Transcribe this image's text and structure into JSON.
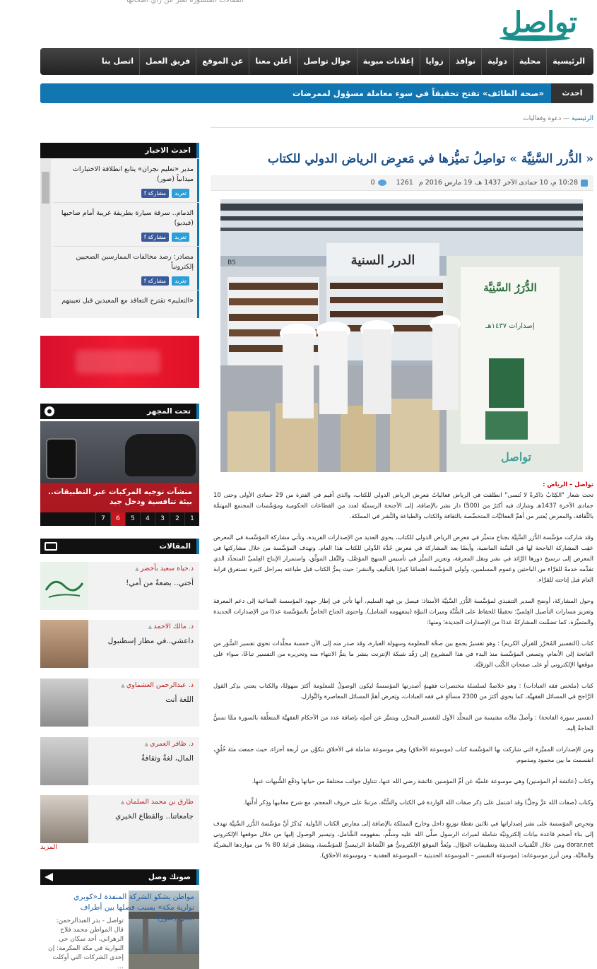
{
  "site": {
    "logo": "تواصل",
    "topline": "المقالات المنشورة تعبّر عن رأي أصحابها"
  },
  "nav": {
    "items": [
      "الرئيسية",
      "محلية",
      "دولية",
      "نوافذ",
      "زوايا",
      "إعلانات مبوبة",
      "جوال تواصل",
      "أعلن معنا",
      "عن الموقع",
      "فريق العمل",
      "اتصل بنا"
    ]
  },
  "ticker": {
    "label": "احدث الأخبار",
    "text": "«صحة الطائف» تفتح تحقيقاً في سوء معاملة مسؤول لممرضات"
  },
  "breadcrumb": {
    "home": "الرئيسية",
    "sep": "—",
    "section": "دعوة وفعاليات"
  },
  "article": {
    "title": "« الدُّرر السَّنِيَّة » تواصِلُ تميُّزها في مَعرِض الرياض الدولي للكتاب",
    "meta": {
      "datetime": "10:28 م، 10 جمادى الآخر 1437 هـ، 19 مارس 2016 م",
      "views": "1261",
      "comments": "0"
    },
    "photo": {
      "booth_sign": "الدرر السنية",
      "booth_code": "B5",
      "poster_title": "الدُّرَرُ السَّنِيَّة",
      "poster_sub": "إصدارات ١٤٣٧هـ",
      "watermark": "تواصل"
    },
    "source": "تواصل – الرياض :",
    "paragraphs": [
      "تحت شعار \"الكِتَابُ ذاكرةٌ لا تُنسى\" انطلقت في الرياض فعالياتُ مَعرِض الرياض الدولي للكتاب، والذي أقيم في الفترة من 29 جمادى الأولى وحتى 10 جمادى الآخرة 1437هـ وشارك فيه أكثرُ من (500) دار نشر بالإضافة، إلى الأجنحة الرسميَّة لعدد من القطاعات الحكومية ومؤسَّسات المجتمع المهتمَّة بالثَّقافة، والمعرض يُعتبر من أهمِّ الفعاليَّات المتخصِّصة بالثقافة والكتاب والطباعة والنَّشر في المملكة.",
      "وقد شاركت مؤسَّسة الدُّرَر السَّنِيَّة بجناح متميِّز في مَعرِض الرياض الدولي للكتاب، يحوي العديد من الإصدارات الفريدة، وتأتي مشاركة المؤسَّسة في المعرض عقِب المشاركة الناجحة لها في السَّنة الماضية، وأيضًا بعد المشاركة في مَعرِض جُدَّة الدَّولي للكتاب هذا العام. وتهدف المؤسَّسة من خلال مشاركتها في المعرض إلى ترسيخ دورها الرَّائد في نشر ونقل المعرفة، وتعزيز التميُّز في تأسيس المنهج المؤصَّل، والنَّقل الموثَّق، واستمرار الإنتاج العِلميِّ المتجدِّد الذي تقدِّمه خدمةً للقرَّاء من الباحثين وعموم المسلمين، وتُولي المؤسَّسة اهتمامًا كبيرًا بالتأليف والنشر؛ حيث يمرُّ الكتاب قبل طباعته بمراحل كثيرة تستغرق قرابة العام قبل إتاحته للقرَّاء.",
      "وحول المشاركة، أوضح المدير التنفيذي لمؤسَّسة الدُّرَر السَّنِيَّة الأستاذ: فيصل بن فهد السليم، أنها تأتي في إطار جهود المؤسسة الساعية إلى دعم المعرفة وتعزيز مَسارات التأصيل العِلميِّ؛ تحقيقًا للحفاظ على السُّنَّة وميراث النبوَّة (بمفهومه الشامل). واحتوى الجناح الخاصُّ بالمؤسَّسة عددًا من الإصدارات الجديدة والمتميِّزة، كما تضمَّنت المشاركةُ عددًا من الإصدارات الجديدة؛ ومنها:",
      "كتاب (التفسير المُحَرَّر للقرآن الكريم) : وهو تفسيرٌ يجمع بين صحَّة المعلومة وسهولة العبارة، وقد صدر منه إلى الآن خمسة مجلَّدات تحوي تفسير السُّوَر من الفاتحة إلى الأنعام، وتسعى المؤسَّسة منذ البدء في هذا المشروع إلى رَفْد شبكة الإنترنت بنشر ما يتمُّ الانتهاء منه وتحريره من التفسير تباعًا، سواء على موقعها الإلكتروني أو على صفحاتِ الكُتُب الورَقيَّة.",
      "كتاب (ملخص فقه العبادات) : وهو خلاصةٌ لسلسلة مختصرات فقهيةٍ أصدرتها المؤسسةُ ليكون الوصولُ للمعلومة أكثرَ سهولةً، والكتاب يعتني بذِكر القول الرَّاجح في المسائل الفقهيَّة، كما يحوي أكثرَ من 2300 مسألةٍ في فقه العبادات، ويَعرض أهمَّ المسائل المعاصرة والنَّوازل.",
      "(تفسير سورة الفاتحة) : وأصلُ مادَّته مقتبسة من المجلَّد الأول للتفسير المحرَّر، ويتميَّز عن أصلِه بإضافة عدد من الأحكام الفقهيَّة المتعلِّقة بالسورة ممَّا تمسُّ الحاجةُ إليه.",
      "ومن الإصدارات المميَّزة التي شاركت بها المؤسَّسة كتاب (موسوعة الأخلاق) وهي موسوعة شاملة في الأخلاق تتكوَّن من أربعة أجزاء، حيث جمعت مئةَ خُلُقٍ، انقسمت ما بين محمود ومذموم.",
      "وكتاب (عائشة أم المؤمنين) وهي موسوعة علميَّة عن أمِّ المؤمنين عائشة رضي الله عنها، تتناول جوانب مختلفةً من حياتها ودَفْع الشُّبهات عنها.",
      "وكتاب (صفات الله عزَّ وجلَّ) وقد اشتمل على ذِكر صفات الله الواردة في الكتاب والسُّنَّة، مرتبةً على حروف المعجم، مع شرح معانيها وذِكر أدلَّتها.",
      "وتحرِص المؤسسة على نشر إصداراتها في ثلاثين نقطةَ توزيعٍ داخل وخارج المملكة بالإضافة إلى معارض الكتاب الدَّولية. يُذكَرُ أنَّ مؤسَّسة الدُّرَر السَّنِيَّة تهدف إلى بناء أضخم قاعدة بيانات إلكترونيَّة شاملة لميراث الرسول صلَّى الله عليه وسلَّم، بمفهومه الشَّامل، وتيسير الوصول إليها من خلال موقعها الإلكتروني dorar.net ومن خلال التَّقنيات الحديثة وتطبيقات الجوَّال. ويُعدُّ الموقع الإلكترونيُّ هو النَّشاط الرئيسيُّ للمؤسَّسة، ويشغل قرابةَ 80 % من مواردها البشريَّة والماليَّة، ومن أبرز موسوعاته: (موسوعة التفسير – الموسوعة الحديثية – الموسوعة العقدية – وموسوعة الأخلاق)."
    ]
  },
  "sidebar": {
    "latest": {
      "title": "احدث الاخبار",
      "share_tw": "تغريد",
      "share_fb": "f مشاركة",
      "items": [
        "مدير «تعليم نجران» يتابع انطلاقة الاختبارات ميدانياً (صور)",
        "الدمام.. سرقة سيارة بطريقة غريبة أمام صاحبها (فيديو)",
        "مصادر: رصد مخالفات الممارسين الصحيين إلكترونياً",
        "«التعليم» تقترح التعاقد مع المعيدين قبل تعيينهم"
      ]
    },
    "micro": {
      "title": "تحت المجهر",
      "caption": "منشآت توجيه المركبات عبر التطبيقات.. بيئة تنافسية ودخل جيد",
      "pages": [
        "1",
        "2",
        "3",
        "4",
        "5",
        "6",
        "7"
      ],
      "active_page": "6"
    },
    "articles": {
      "title": "المقالات",
      "items": [
        {
          "author": "د.حياة سعيد بأخضر",
          "title": "أختي.. بضعةٌ من أمي!"
        },
        {
          "author": "د. مالك الاحمد",
          "title": "داعشي..في مطار إسطنبول"
        },
        {
          "author": "د. عبدالرحمن العشماوي",
          "title": "اللغة أنت"
        },
        {
          "author": "د. ظافر العمري",
          "title": "المال، لغةٌ وثقافةٌ"
        },
        {
          "author": "طارق بن محمد السلمان",
          "title": "جامعاتنا.. والقطاع الخيري"
        }
      ],
      "more": "المزيد"
    },
    "audio": {
      "title": "صوتك وصل",
      "item_title": "مواطن يشكو الشركة المنفذة لـ«كوبري نوارية مكة» بسبب فصلها بين أطراف الحي (صور)",
      "item_text": "تواصل - بدر العبدالرحمن: قال المواطن محمد فلاح الزهراني، أحد سكان حي النوارية في مكة المكرمة: إن إحدى الشركات التي أوكلت ..."
    }
  }
}
